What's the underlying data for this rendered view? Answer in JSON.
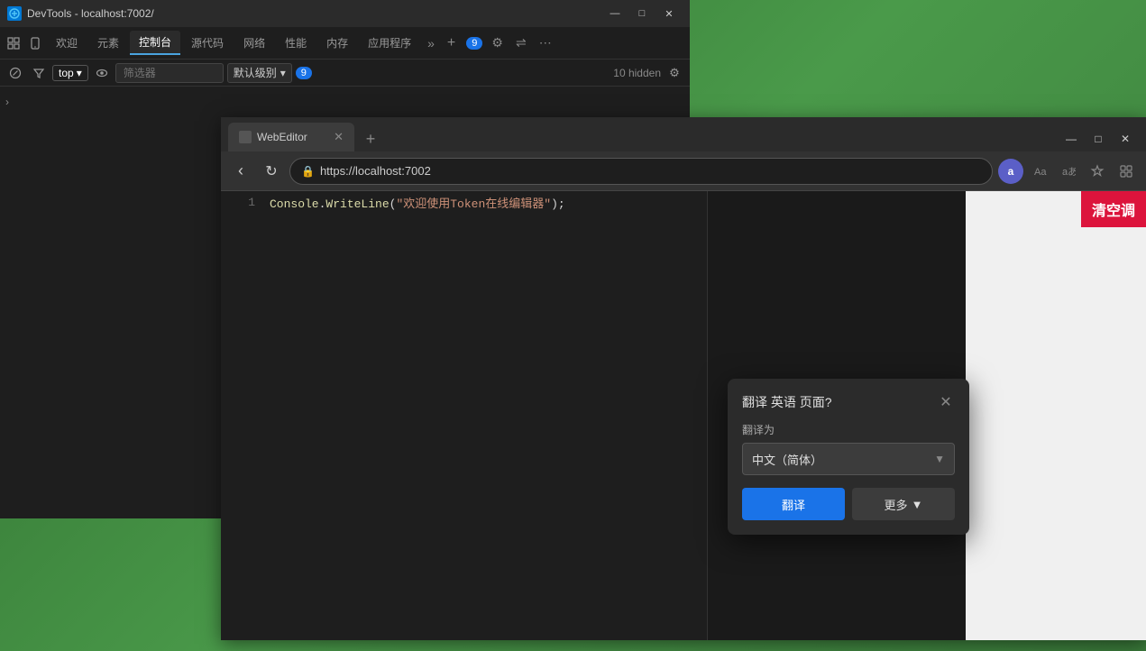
{
  "desktop": {
    "background": "#3a7a3a"
  },
  "devtools": {
    "titlebar": {
      "title": "DevTools - localhost:7002/",
      "minimize": "—",
      "maximize": "□",
      "close": "✕"
    },
    "tabs": [
      {
        "label": "欢迎",
        "active": false
      },
      {
        "label": "元素",
        "active": false
      },
      {
        "label": "控制台",
        "active": true
      },
      {
        "label": "源代码",
        "active": false
      },
      {
        "label": "网络",
        "active": false
      },
      {
        "label": "性能",
        "active": false
      },
      {
        "label": "内存",
        "active": false
      },
      {
        "label": "应用程序",
        "active": false
      }
    ],
    "badge_count": "9",
    "toolbar": {
      "top_label": "top",
      "filter_placeholder": "筛选器",
      "level_label": "默认级别",
      "badge_9": "9",
      "hidden_label": "10 hidden"
    }
  },
  "browser": {
    "tab": {
      "label": "WebEditor",
      "close": "✕",
      "new_tab": "+"
    },
    "window_controls": {
      "minimize": "—",
      "maximize": "□",
      "close": "✕"
    },
    "address": {
      "url": "https://localhost:7002",
      "back": "‹",
      "forward": "›",
      "refresh": "↻"
    },
    "code": {
      "line_number": "1",
      "content": "Console.WriteLine(\"欢迎使用Token在线编辑器\");"
    }
  },
  "translate_popup": {
    "title": "翻译 英语 页面?",
    "close": "✕",
    "label_translate_to": "翻译为",
    "selected_language": "中文（简体）",
    "btn_translate": "翻译",
    "btn_more": "更多",
    "btn_more_arrow": "▼"
  },
  "banner": {
    "text": "清空调"
  },
  "icons": {
    "expand_arrow": "›",
    "chevron_down": "▾",
    "lock": "🔒",
    "gear": "⚙",
    "caret_down": "▾",
    "eye": "👁",
    "block": "🚫",
    "chevron_right": "›"
  }
}
